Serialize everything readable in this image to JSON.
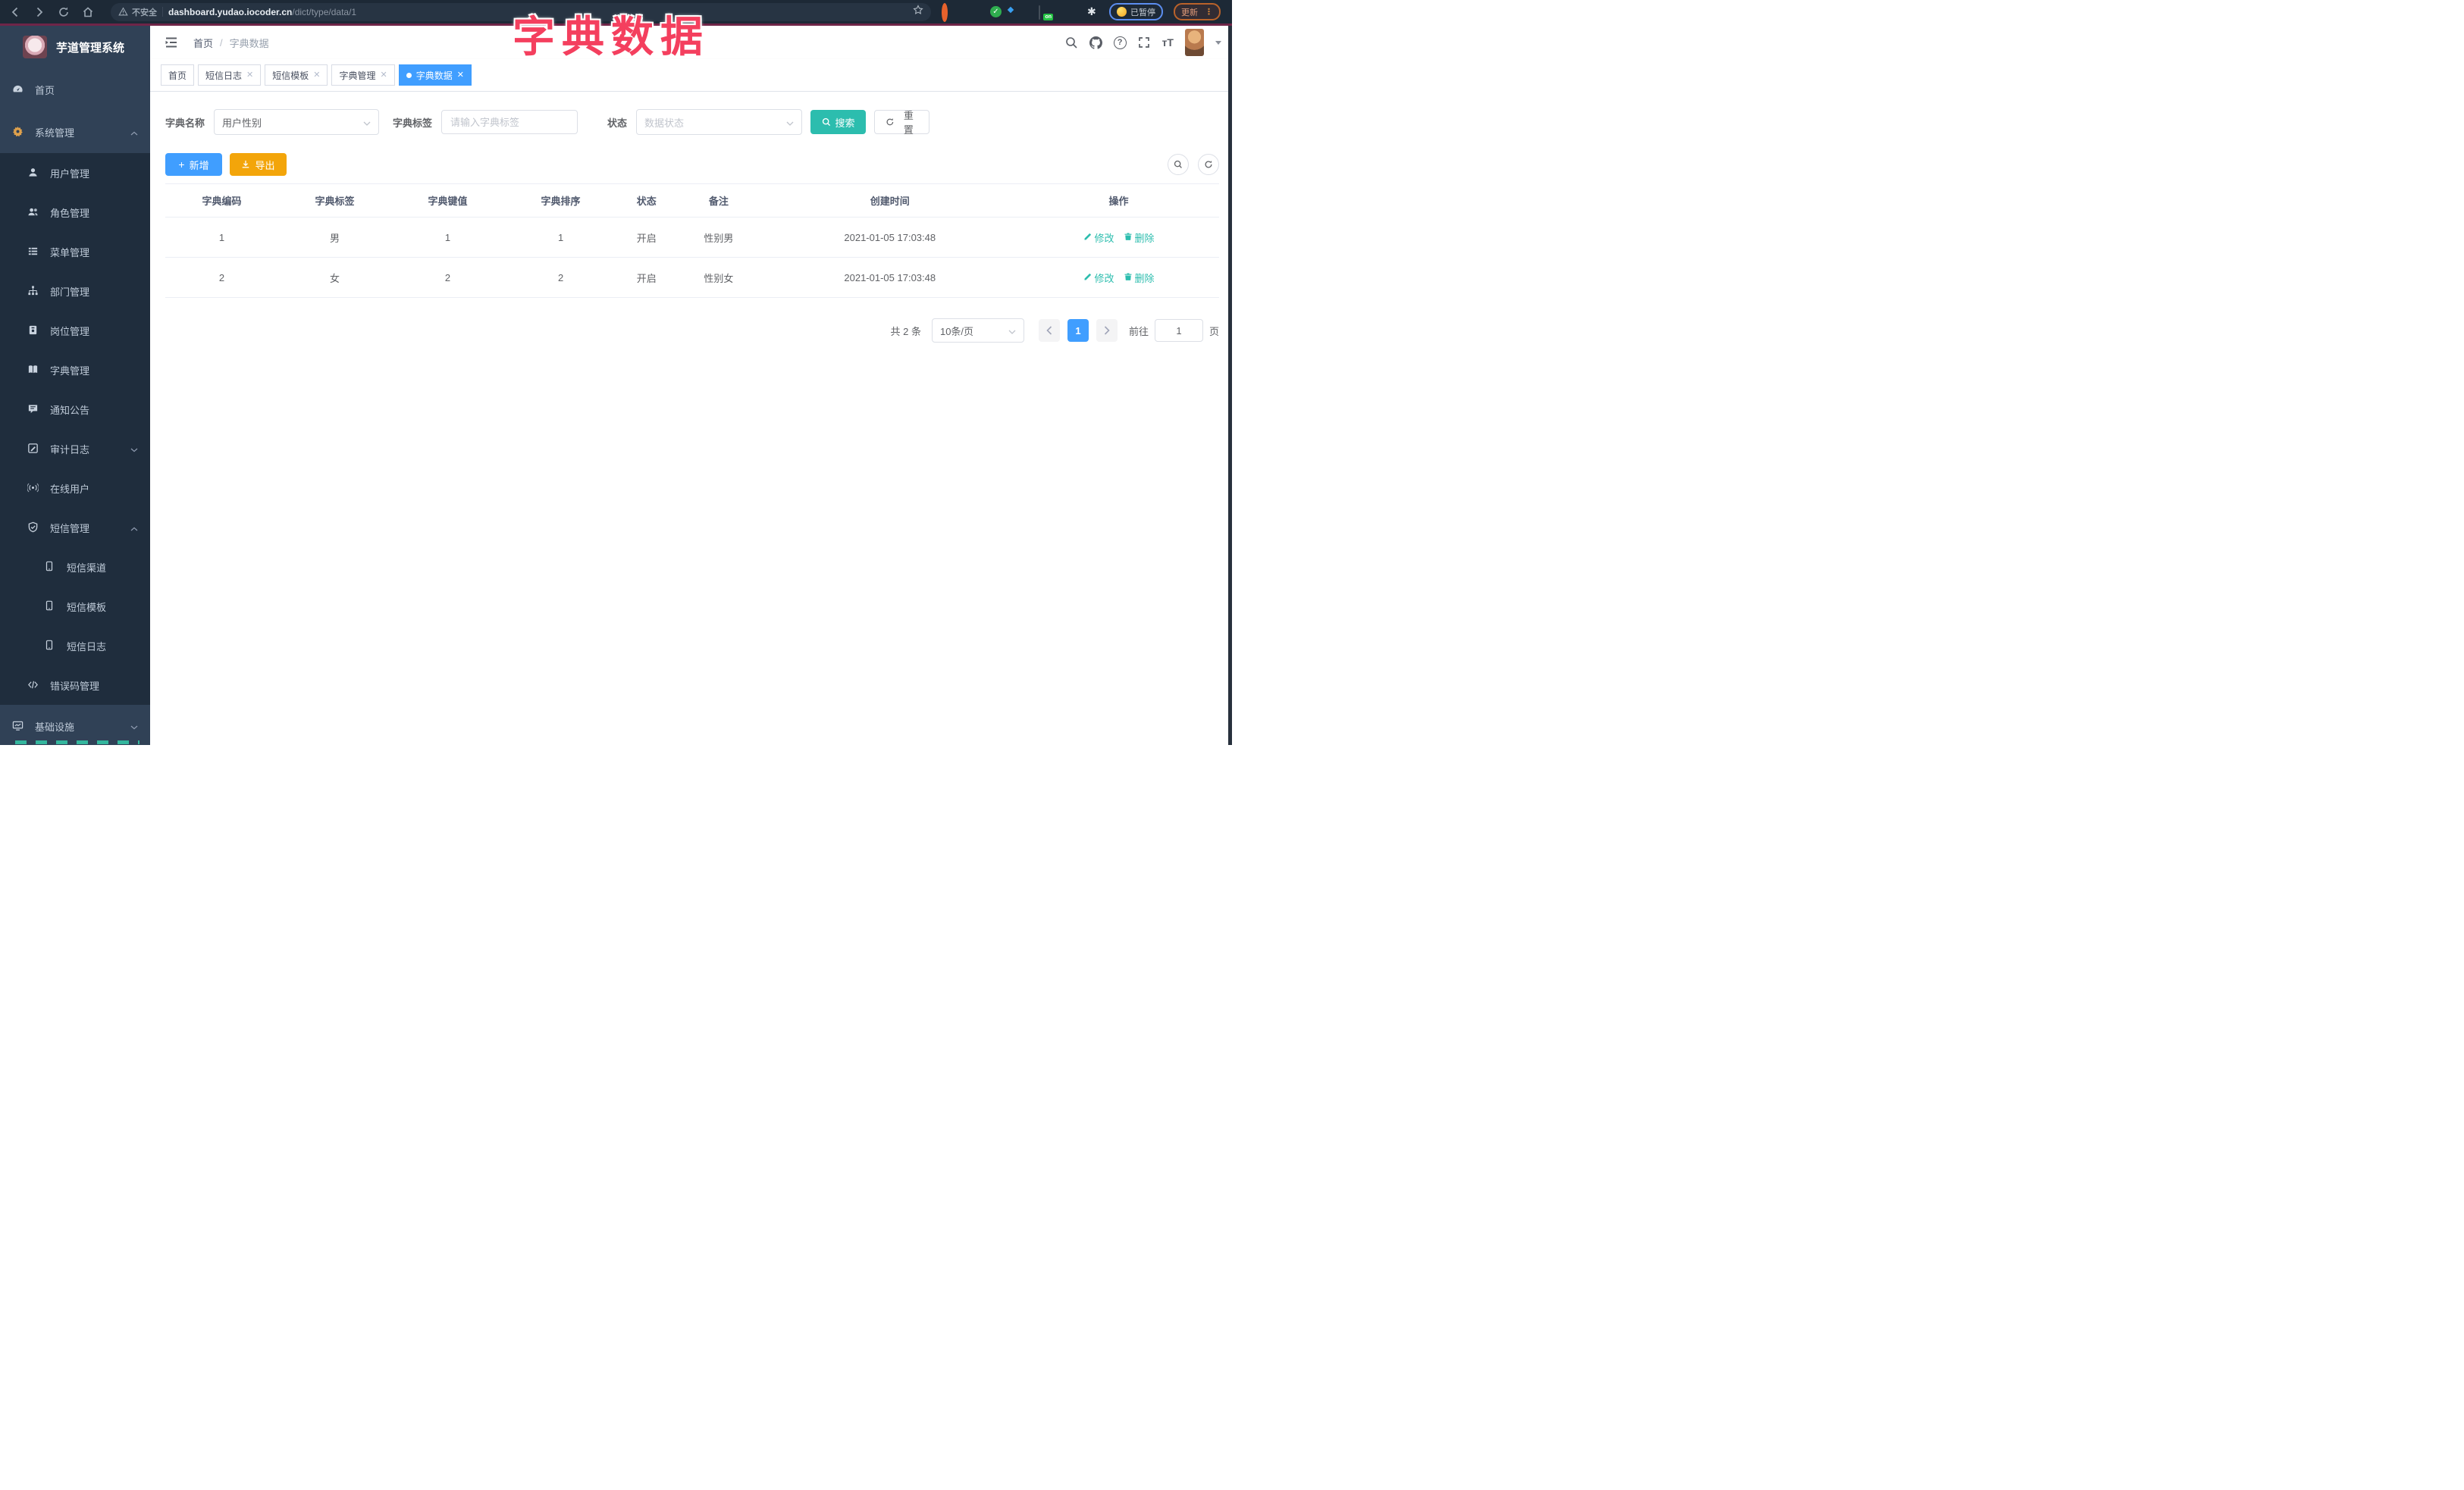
{
  "browser": {
    "security_warning": "不安全",
    "url_host": "dashboard.yudao.iocoder.cn",
    "url_path": "/dict/type/data/1",
    "extension_on_badge": "on",
    "profile_status": "已暂停",
    "update_label": "更新"
  },
  "annotation": {
    "title": "字典数据",
    "title_color": "#f43f5e",
    "underline_color": "#6f2548"
  },
  "sidebar": {
    "logo_title": "芋道管理系统",
    "items": [
      {
        "label": "首页",
        "icon": "dashboard-icon",
        "level": 1
      },
      {
        "label": "系统管理",
        "icon": "gear-icon",
        "level": 1,
        "chevron": "up",
        "icon_color": "#dfa14c"
      },
      {
        "label": "用户管理",
        "icon": "user-icon",
        "level": 2
      },
      {
        "label": "角色管理",
        "icon": "users-icon",
        "level": 2
      },
      {
        "label": "菜单管理",
        "icon": "menu-icon",
        "level": 2
      },
      {
        "label": "部门管理",
        "icon": "tree-icon",
        "level": 2
      },
      {
        "label": "岗位管理",
        "icon": "badge-icon",
        "level": 2
      },
      {
        "label": "字典管理",
        "icon": "book-icon",
        "level": 2
      },
      {
        "label": "通知公告",
        "icon": "message-icon",
        "level": 2
      },
      {
        "label": "审计日志",
        "icon": "log-icon",
        "level": 2,
        "chevron": "down"
      },
      {
        "label": "在线用户",
        "icon": "online-icon",
        "level": 2
      },
      {
        "label": "短信管理",
        "icon": "shield-icon",
        "level": 2,
        "chevron": "up"
      },
      {
        "label": "短信渠道",
        "icon": "phone-icon",
        "level": 3
      },
      {
        "label": "短信模板",
        "icon": "phone-icon",
        "level": 3
      },
      {
        "label": "短信日志",
        "icon": "phone-icon",
        "level": 3
      },
      {
        "label": "错误码管理",
        "icon": "code-icon",
        "level": 2
      },
      {
        "label": "基础设施",
        "icon": "monitor-icon",
        "level": 1,
        "chevron": "down"
      }
    ]
  },
  "topbar": {
    "breadcrumb_home": "首页",
    "breadcrumb_sep": "/",
    "breadcrumb_current": "字典数据"
  },
  "tabs": [
    {
      "label": "首页",
      "closable": false,
      "active": false
    },
    {
      "label": "短信日志",
      "closable": true,
      "active": false
    },
    {
      "label": "短信模板",
      "closable": true,
      "active": false
    },
    {
      "label": "字典管理",
      "closable": true,
      "active": false
    },
    {
      "label": "字典数据",
      "closable": true,
      "active": true
    }
  ],
  "filters": {
    "name_label": "字典名称",
    "name_value": "用户性别",
    "tag_label": "字典标签",
    "tag_placeholder": "请输入字典标签",
    "status_label": "状态",
    "status_placeholder": "数据状态",
    "search_label": "搜索",
    "reset_label": "重置"
  },
  "toolbar": {
    "add_label": "新增",
    "export_label": "导出"
  },
  "table": {
    "columns": [
      "字典编码",
      "字典标签",
      "字典键值",
      "字典排序",
      "状态",
      "备注",
      "创建时间",
      "操作"
    ],
    "rows": [
      {
        "code": "1",
        "label": "男",
        "value": "1",
        "sort": "1",
        "status": "开启",
        "remark": "性别男",
        "created": "2021-01-05 17:03:48"
      },
      {
        "code": "2",
        "label": "女",
        "value": "2",
        "sort": "2",
        "status": "开启",
        "remark": "性别女",
        "created": "2021-01-05 17:03:48"
      }
    ],
    "edit_label": "修改",
    "delete_label": "删除"
  },
  "pagination": {
    "total_text": "共 2 条",
    "page_size_value": "10条/页",
    "current_page": "1",
    "goto_label": "前往",
    "goto_value": "1",
    "unit_label": "页"
  },
  "colors": {
    "primary": "#409eff",
    "teal": "#2cbdae",
    "amber": "#f3a50a",
    "sidebar_bg": "#304156",
    "submenu_bg": "#1f2d3d",
    "chrome_bg": "#1d2936"
  }
}
